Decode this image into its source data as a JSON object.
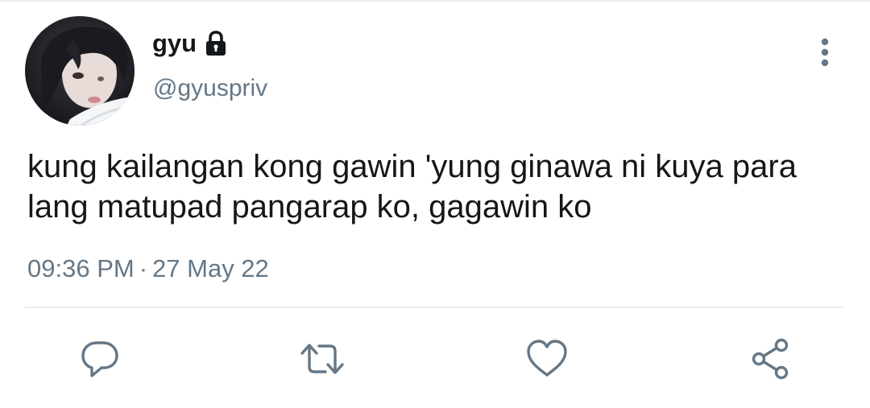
{
  "tweet": {
    "author": {
      "display_name": "gyu",
      "handle": "@gyuspriv",
      "protected": true,
      "avatar": "profile-photo"
    },
    "text": "kung kailangan kong gawin 'yung ginawa ni kuya para\nlang matupad pangarap ko, gagawin ko",
    "time": "09:36 PM",
    "separator": "·",
    "date": "27 May 22"
  },
  "actions": [
    {
      "name": "reply",
      "icon": "reply-icon"
    },
    {
      "name": "retweet",
      "icon": "retweet-icon"
    },
    {
      "name": "like",
      "icon": "heart-icon"
    },
    {
      "name": "share",
      "icon": "share-icon"
    }
  ],
  "colors": {
    "text": "#14171a",
    "secondary": "#657786",
    "divider": "#e6ecf0"
  }
}
